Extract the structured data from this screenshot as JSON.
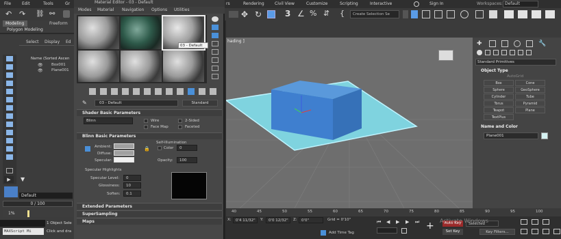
{
  "menubar": {
    "items": [
      "File",
      "Edit",
      "Tools",
      "Gr",
      "rs",
      "Rendering",
      "Civil View",
      "Customize",
      "Scripting",
      "Interactive"
    ],
    "sign_in": "Sign In",
    "workspaces_label": "Workspaces:",
    "workspaces_value": "Default"
  },
  "toolbar": {
    "selection_set_placeholder": "Create Selection Se"
  },
  "ribbon": {
    "tabs": [
      "Modeling",
      "Freeform"
    ],
    "subtab": "Polygon Modeling"
  },
  "scene_explorer": {
    "tabs": [
      "Select",
      "Display",
      "Ed"
    ],
    "sort_header": "Name (Sorted Ascen",
    "items": [
      "Box001",
      "Plane001"
    ],
    "layer_default": "Default",
    "frame_counter": "0 / 100"
  },
  "prompt": {
    "maxscript": "MAXScript Mi",
    "selection_status": "1 Object Sele",
    "hint": "Click and dra",
    "percent": "1%"
  },
  "material_editor": {
    "title": "Material Editor - 03 - Default",
    "menu": [
      "Modes",
      "Material",
      "Navigation",
      "Options",
      "Utilities"
    ],
    "tooltip": "03 - Default",
    "material_name": "03 - Default",
    "material_type": "Standard",
    "shader_rollout": "Shader Basic Parameters",
    "shader_type": "Blinn",
    "wire": "Wire",
    "two_sided": "2-Sided",
    "face_map": "Face Map",
    "faceted": "Faceted",
    "blinn_rollout": "Blinn Basic Parameters",
    "self_illum": "Self-Illumination",
    "color_label": "Color",
    "color_value": "0",
    "ambient": "Ambient:",
    "diffuse": "Diffuse:",
    "specular": "Specular:",
    "opacity_label": "Opacity:",
    "opacity_value": "100",
    "spec_highlights": "Specular Highlights",
    "spec_level_label": "Specular Level:",
    "spec_level_value": "0",
    "glossiness_label": "Glossiness:",
    "glossiness_value": "10",
    "soften_label": "Soften:",
    "soften_value": "0.1",
    "extended_rollout": "Extended Parameters",
    "supersampling_rollout": "SuperSampling",
    "maps_rollout": "Maps"
  },
  "viewport": {
    "label": "hading ]"
  },
  "command_panel": {
    "category": "Standard Primitives",
    "object_type_header": "Object Type",
    "autogrid": "AutoGrid",
    "buttons": [
      "Box",
      "Cone",
      "Sphere",
      "GeoSphere",
      "Cylinder",
      "Tube",
      "Torus",
      "Pyramid",
      "Teapot",
      "Plane",
      "TextPlus"
    ],
    "name_color_header": "Name and Color",
    "object_name": "Plane001",
    "object_color": "#d5f2f2"
  },
  "timeline": {
    "ticks": [
      "40",
      "45",
      "50",
      "55",
      "60",
      "65",
      "70",
      "75",
      "80",
      "85",
      "90",
      "95",
      "100"
    ]
  },
  "status": {
    "x_label": "X:",
    "x_value": "0'4 11/32\"",
    "y_label": "Y:",
    "y_value": "0'0 12/32\"",
    "z_label": "Z:",
    "z_value": "0'0\"",
    "grid": "Grid = 0'10\"",
    "add_time_tag": "Add Time Tag",
    "auto_key": "Auto Key",
    "selected": "Selected",
    "set_key": "Set Key",
    "key_filters": "Key Filters...",
    "watermark_line1": "Activate Windows",
    "watermark_line2": "Go to Settings to activate Windows."
  },
  "colors": {
    "accent_blue": "#4a90d9",
    "box_blue": "#3f7fcf",
    "plane_cyan": "#7fd3df",
    "auto_key_red": "#9b2a2a"
  }
}
